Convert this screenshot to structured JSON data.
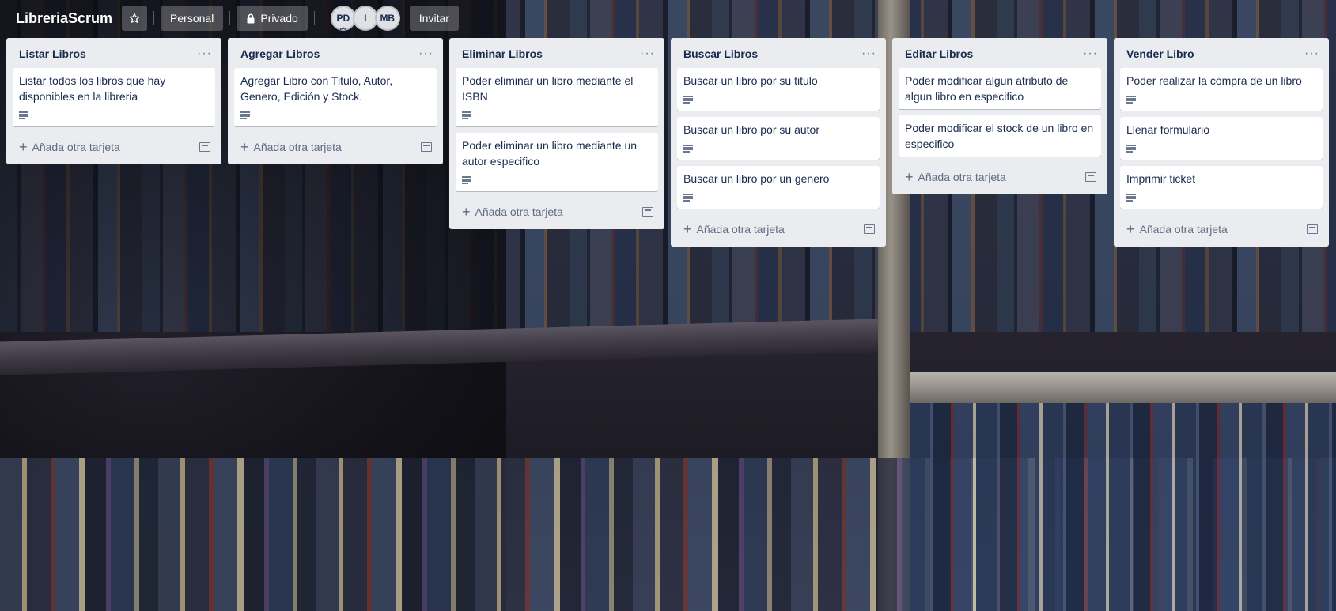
{
  "header": {
    "board_title": "LibreriaScrum",
    "star_icon": "star-icon",
    "visibility_team": "Personal",
    "visibility_privacy": "Privado",
    "privacy_icon": "lock-icon",
    "members": [
      "PD",
      "I",
      "MB"
    ],
    "invite_label": "Invitar"
  },
  "lists": [
    {
      "title": "Listar Libros",
      "cards": [
        {
          "title": "Listar todos los libros que hay disponibles en la libreria",
          "has_description": true
        }
      ],
      "add_label": "Añada otra tarjeta"
    },
    {
      "title": "Agregar Libros",
      "cards": [
        {
          "title": "Agregar Libro con Titulo, Autor, Genero, Edición y Stock.",
          "has_description": true
        }
      ],
      "add_label": "Añada otra tarjeta"
    },
    {
      "title": "Eliminar Libros",
      "cards": [
        {
          "title": "Poder eliminar un libro mediante el ISBN",
          "has_description": true
        },
        {
          "title": "Poder eliminar un libro mediante un autor especifico",
          "has_description": true
        }
      ],
      "add_label": "Añada otra tarjeta"
    },
    {
      "title": "Buscar Libros",
      "cards": [
        {
          "title": "Buscar un libro por su titulo",
          "has_description": true
        },
        {
          "title": "Buscar un libro por su autor",
          "has_description": true
        },
        {
          "title": "Buscar un libro por un genero",
          "has_description": true
        }
      ],
      "add_label": "Añada otra tarjeta"
    },
    {
      "title": "Editar Libros",
      "cards": [
        {
          "title": "Poder modificar algun atributo de algun libro en especifico",
          "has_description": false
        },
        {
          "title": "Poder modificar el stock de un libro en especifico",
          "has_description": false
        }
      ],
      "add_label": "Añada otra tarjeta"
    },
    {
      "title": "Vender Libro",
      "cards": [
        {
          "title": "Poder realizar la compra de un libro",
          "has_description": true
        },
        {
          "title": "Llenar formulario",
          "has_description": true
        },
        {
          "title": "Imprimir ticket",
          "has_description": true
        }
      ],
      "add_label": "Añada otra tarjeta"
    }
  ]
}
